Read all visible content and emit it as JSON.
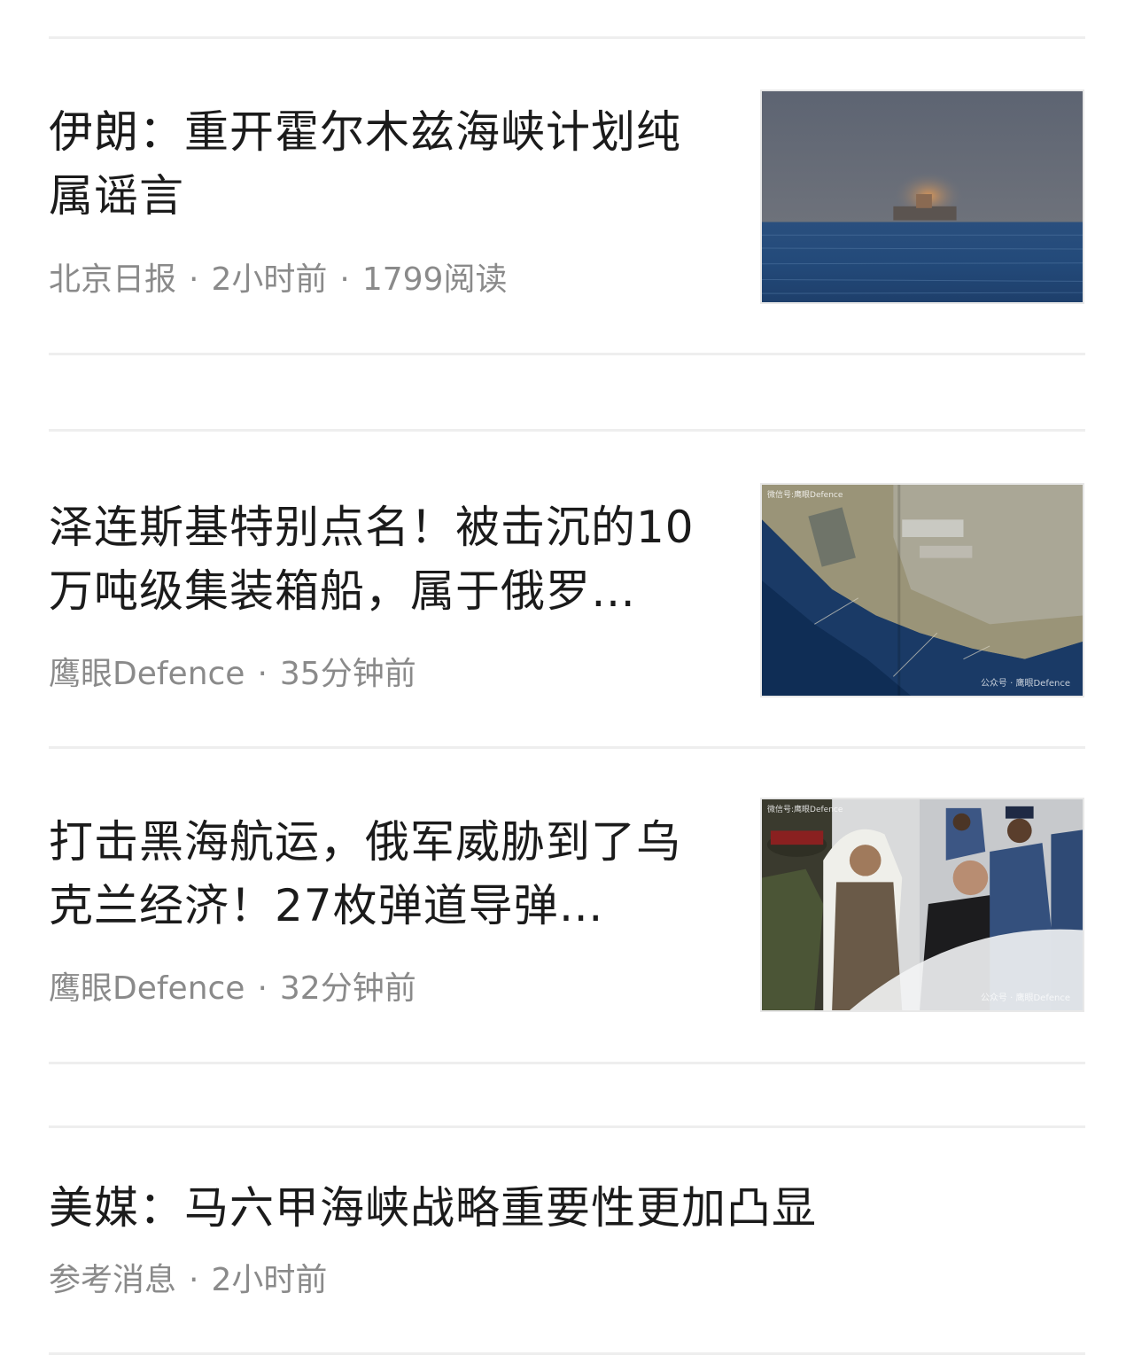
{
  "feed": [
    {
      "title": "伊朗：重开霍尔木兹海峡计划纯属谣言",
      "source": "北京日报",
      "time": "2小时前",
      "reads": "1799阅读",
      "thumbnail": "tanker-on-sea-image"
    },
    {
      "title": "泽连斯基特别点名！被击沉的10万吨级集装箱船，属于俄罗…",
      "source": "鹰眼Defence",
      "time": "35分钟前",
      "thumbnail": "satellite-coast-image",
      "watermark": "公众号 · 鹰眼Defence",
      "watermark_top": "微信号:鹰眼Defence"
    },
    {
      "title": "打击黑海航运，俄军威胁到了乌克兰经济！27枚弹道导弹…",
      "source": "鹰眼Defence",
      "time": "32分钟前",
      "thumbnail": "leaders-handshake-image",
      "watermark": "公众号 · 鹰眼Defence",
      "watermark_top": "微信号:鹰眼Defence"
    },
    {
      "title": "美媒：马六甲海峡战略重要性更加凸显",
      "source": "参考消息",
      "time": "2小时前"
    }
  ],
  "separator": "·"
}
